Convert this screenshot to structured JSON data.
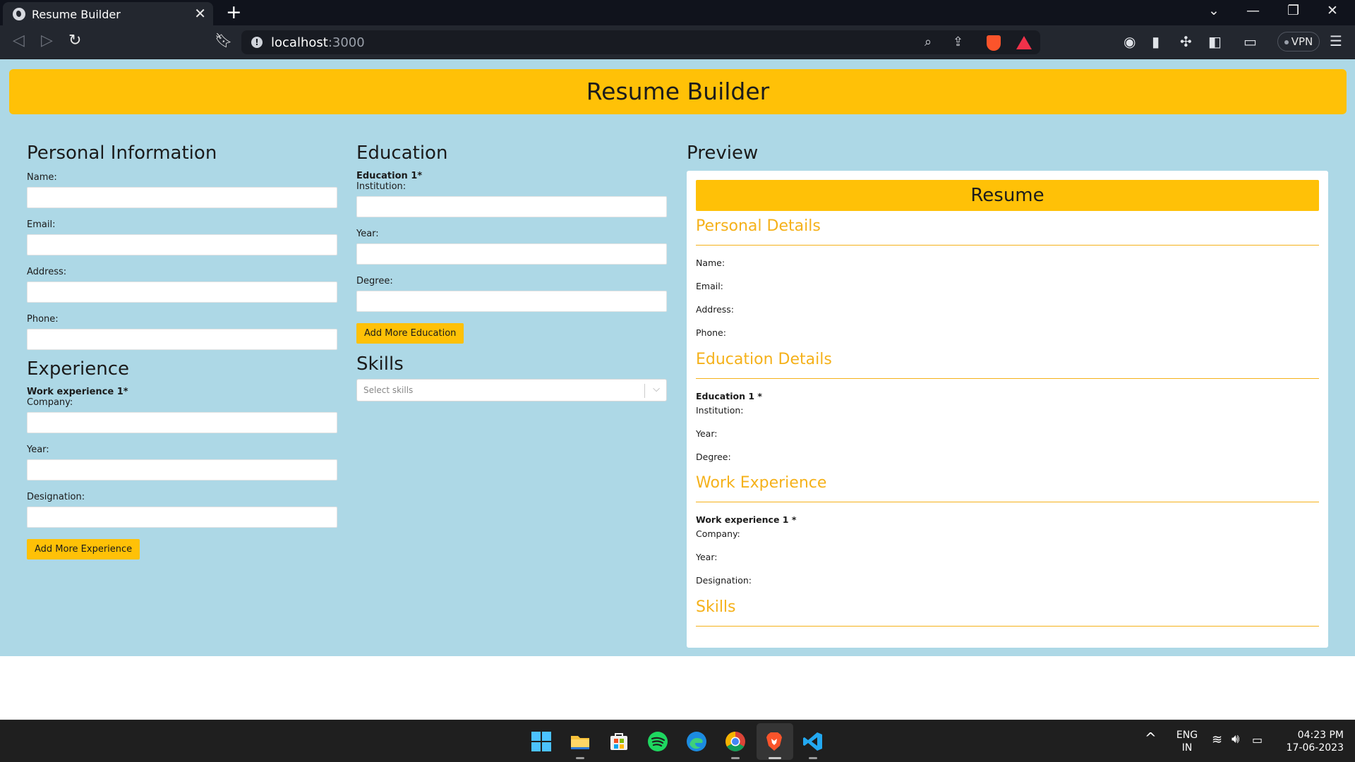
{
  "browser": {
    "tab_title": "Resume Builder",
    "url_host": "localhost",
    "url_port": ":3000",
    "vpn_label": "VPN"
  },
  "app": {
    "title": "Resume Builder"
  },
  "personal": {
    "heading": "Personal Information",
    "name_label": "Name:",
    "email_label": "Email:",
    "address_label": "Address:",
    "phone_label": "Phone:",
    "name_value": "",
    "email_value": "",
    "address_value": "",
    "phone_value": ""
  },
  "experience": {
    "heading": "Experience",
    "entry_title": "Work experience 1*",
    "company_label": "Company:",
    "year_label": "Year:",
    "designation_label": "Designation:",
    "add_button": "Add More Experience"
  },
  "education": {
    "heading": "Education",
    "entry_title": "Education 1*",
    "institution_label": "Institution:",
    "year_label": "Year:",
    "degree_label": "Degree:",
    "add_button": "Add More Education"
  },
  "skills": {
    "heading": "Skills",
    "placeholder": "Select skills"
  },
  "preview": {
    "heading": "Preview",
    "resume_title": "Resume",
    "personal_heading": "Personal Details",
    "name": "Name:",
    "email": "Email:",
    "address": "Address:",
    "phone": "Phone:",
    "education_heading": "Education Details",
    "education_entry": "Education 1 *",
    "institution": "Institution:",
    "edu_year": "Year:",
    "degree": "Degree:",
    "work_heading": "Work Experience",
    "work_entry": "Work experience 1 *",
    "company": "Company:",
    "work_year": "Year:",
    "designation": "Designation:",
    "skills_heading": "Skills"
  },
  "taskbar": {
    "lang_top": "ENG",
    "lang_bottom": "IN",
    "time": "04:23 PM",
    "date": "17-06-2023"
  },
  "colors": {
    "accent": "#ffc107",
    "page_bg": "#add8e6",
    "section_heading": "#f5b11a"
  }
}
